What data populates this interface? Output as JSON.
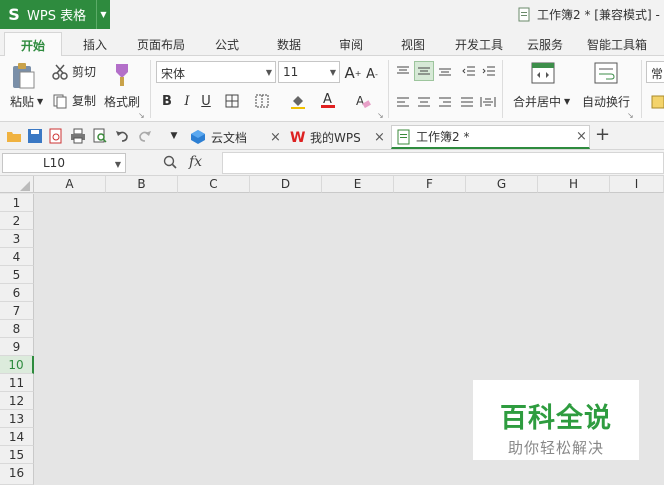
{
  "app": {
    "name": "WPS 表格",
    "logo": "S"
  },
  "window": {
    "doc_title": "工作簿2 * [兼容模式] -"
  },
  "ribbon_tabs": [
    "开始",
    "插入",
    "页面布局",
    "公式",
    "数据",
    "审阅",
    "视图",
    "开发工具",
    "云服务",
    "智能工具箱"
  ],
  "ribbon": {
    "paste": "粘贴",
    "cut": "剪切",
    "copy": "复制",
    "format_painter": "格式刷",
    "font_name": "宋体",
    "font_size": "11",
    "merge_center": "合并居中",
    "wrap_text": "自动换行",
    "partial_label": "常"
  },
  "doc_tabs": [
    {
      "label": "云文档"
    },
    {
      "label": "我的WPS"
    },
    {
      "label": "工作簿2 *"
    }
  ],
  "formula_bar": {
    "name_box": "L10",
    "fx": "fx"
  },
  "columns": [
    "A",
    "B",
    "C",
    "D",
    "E",
    "F",
    "G",
    "H",
    "I"
  ],
  "rows": [
    "1",
    "2",
    "3",
    "4",
    "5",
    "6",
    "7",
    "8",
    "9",
    "10",
    "11",
    "12",
    "13",
    "14",
    "15",
    "16"
  ],
  "active_row": "10",
  "watermark": {
    "title": "百科全说",
    "subtitle": "助你轻松解决"
  },
  "colors": {
    "accent": "#2e8b3e",
    "watermark_green": "#2e9c3f"
  }
}
